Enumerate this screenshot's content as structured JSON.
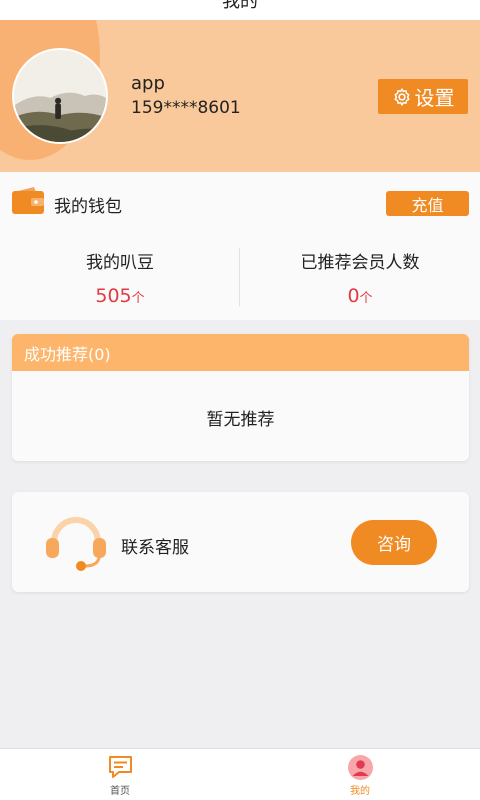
{
  "header": {
    "title": "我的"
  },
  "profile": {
    "name": "app",
    "phone": "159****8601",
    "settings_label": "设置"
  },
  "wallet": {
    "title": "我的钱包",
    "recharge_label": "充值",
    "stats": [
      {
        "label": "我的叭豆",
        "value": "505",
        "unit": "个"
      },
      {
        "label": "已推荐会员人数",
        "value": "0",
        "unit": "个"
      }
    ]
  },
  "recommend": {
    "header": "成功推荐(0)",
    "empty_text": "暂无推荐"
  },
  "service": {
    "label": "联系客服",
    "consult_label": "咨询"
  },
  "tabs": [
    {
      "label": "首页",
      "icon": "message-icon",
      "active": false
    },
    {
      "label": "我的",
      "icon": "user-icon",
      "active": true
    }
  ],
  "colors": {
    "accent": "#f08a22",
    "profile_bg": "#f9c99b",
    "recommend_header": "#fdb56b",
    "stat_value": "#e23a45"
  }
}
